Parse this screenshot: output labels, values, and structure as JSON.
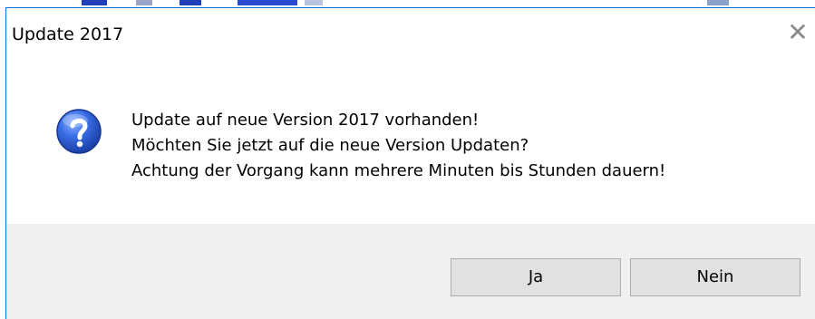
{
  "dialog": {
    "title": "Update 2017",
    "close_glyph": "✕",
    "icon": "question-icon",
    "message_lines": [
      "Update auf neue Version 2017 vorhanden!",
      "Möchten Sie jetzt auf die neue Version Updaten?",
      "Achtung der Vorgang kann mehrere Minuten bis Stunden dauern!"
    ],
    "buttons": {
      "yes_label": "Ja",
      "no_label": "Nein"
    }
  },
  "colors": {
    "accent": "#0b6fd1",
    "icon_blue": "#2a5bd7",
    "footer_bg": "#f0f0f0",
    "button_bg": "#e1e1e1"
  }
}
